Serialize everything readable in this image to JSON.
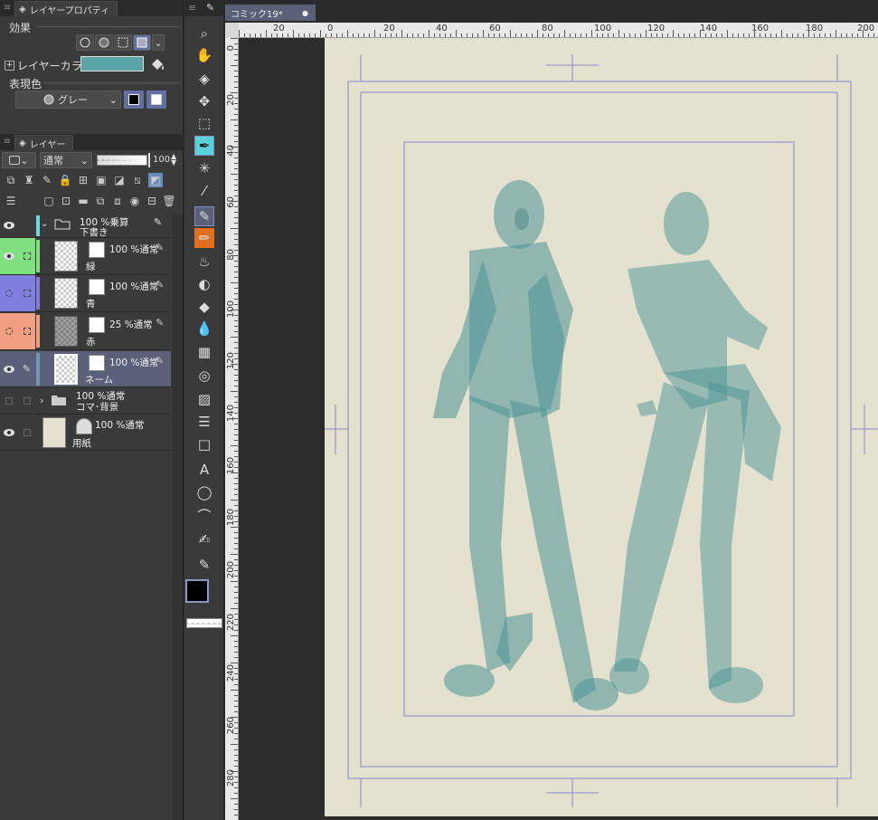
{
  "layer_property_panel": {
    "tab_title": "レイヤープロパティ",
    "effect_label": "効果",
    "layer_color_label": "レイヤーカラー",
    "layer_color": "#5ba4a8",
    "expression_color_label": "表現色",
    "expression_color_value": "グレー"
  },
  "layer_panel": {
    "tab_title": "レイヤー",
    "blend_mode": "通常",
    "opacity": "100"
  },
  "layers": [
    {
      "opacity_mode": "100 %乗算",
      "name": "下書き",
      "type": "folder",
      "color": "#66dddd"
    },
    {
      "opacity_mode": "100 %通常",
      "name": "緑",
      "color": "#7fe07f"
    },
    {
      "opacity_mode": "100 %通常",
      "name": "青",
      "color": "#7f7fe0"
    },
    {
      "opacity_mode": "25 %通常",
      "name": "赤",
      "color": "#f0a080"
    },
    {
      "opacity_mode": "100 %通常",
      "name": "ネーム",
      "color": "#6a9ab0"
    },
    {
      "opacity_mode": "100 %通常",
      "name": "コマ･背景",
      "type": "folder"
    },
    {
      "opacity_mode": "100 %通常",
      "name": "用紙"
    }
  ],
  "document": {
    "tab_title": "コミック19*"
  },
  "ruler": {
    "h_labels": [
      "20",
      "0",
      "20",
      "40",
      "60",
      "80",
      "100",
      "120",
      "140",
      "160",
      "180",
      "200"
    ],
    "v_labels": [
      "0",
      "20",
      "40",
      "60",
      "80",
      "100",
      "120",
      "140",
      "160",
      "180",
      "200",
      "220",
      "240",
      "260",
      "280"
    ]
  },
  "colors": {
    "paper": "#e4e1cf",
    "figure": "#4a9496",
    "selection": "#5a6078",
    "guide": "#8888cc"
  }
}
